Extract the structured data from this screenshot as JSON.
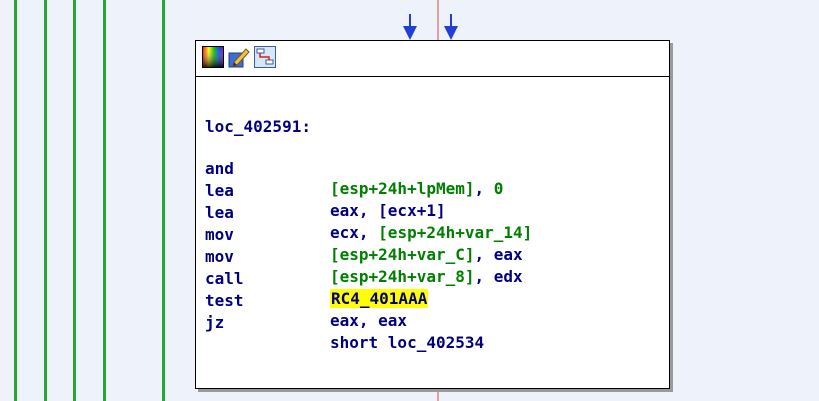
{
  "graph": {
    "colors": {
      "edge_green": "#2aa534",
      "arrow_blue": "#1f3fd6",
      "highlight": "#ffff00",
      "code_color": "#000080",
      "operand_green": "#008000"
    }
  },
  "node": {
    "toolbar_icons": [
      "color-palette-icon",
      "edit-node-icon",
      "graph-layout-icon"
    ],
    "label": "loc_402591:",
    "instructions": [
      {
        "mnemonic": "and",
        "operand_parts": [
          {
            "t": "[esp+24h+lpMem]",
            "c": "var"
          },
          {
            "t": ", ",
            "c": "plain"
          },
          {
            "t": "0",
            "c": "num"
          }
        ]
      },
      {
        "mnemonic": "lea",
        "operand_parts": [
          {
            "t": "eax, [ecx+1]",
            "c": "plain"
          }
        ]
      },
      {
        "mnemonic": "lea",
        "operand_parts": [
          {
            "t": "ecx, ",
            "c": "plain"
          },
          {
            "t": "[esp+24h+var_14]",
            "c": "var"
          }
        ]
      },
      {
        "mnemonic": "mov",
        "operand_parts": [
          {
            "t": "[esp+24h+var_C]",
            "c": "var"
          },
          {
            "t": ", eax",
            "c": "plain"
          }
        ]
      },
      {
        "mnemonic": "mov",
        "operand_parts": [
          {
            "t": "[esp+24h+var_8]",
            "c": "var"
          },
          {
            "t": ", edx",
            "c": "plain"
          }
        ]
      },
      {
        "mnemonic": "call",
        "operand_parts": [
          {
            "t": "RC4_401AAA",
            "c": "hl"
          }
        ]
      },
      {
        "mnemonic": "test",
        "operand_parts": [
          {
            "t": "eax, eax",
            "c": "plain"
          }
        ]
      },
      {
        "mnemonic": "jz",
        "operand_parts": [
          {
            "t": "short loc_402534",
            "c": "plain"
          }
        ]
      }
    ]
  }
}
